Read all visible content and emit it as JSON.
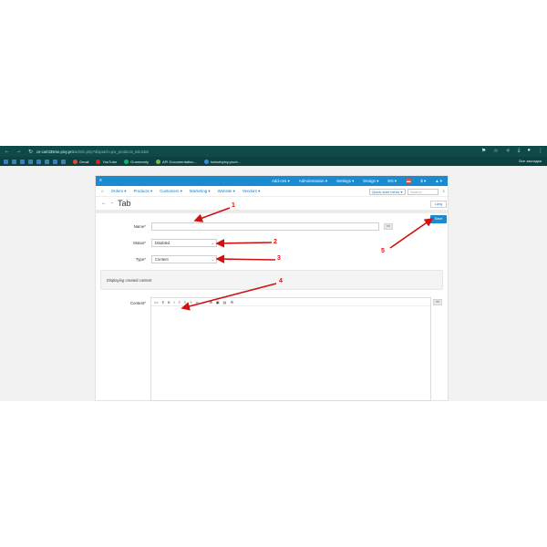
{
  "browser": {
    "url_host": "cs-cart435me.pixy.pro",
    "url_path": "/admin.php?dispatch=pw_products_tab.tabs",
    "bookmarks": [
      {
        "label": "Gmail",
        "color": "#e14a3a"
      },
      {
        "label": "YouTube",
        "color": "#e02020"
      },
      {
        "label": "Grammarly",
        "color": "#15b06b"
      },
      {
        "label": "API Documentation...",
        "color": "#7ab648"
      },
      {
        "label": "hotwebpixy.pro/e...",
        "color": "#3b8cd8"
      }
    ],
    "bookmarks_right": "Все закладки"
  },
  "topbar": {
    "items": [
      "Add-ons ▾",
      "Administration ▾",
      "Settings ▾",
      "Design ▾",
      "EN ▾",
      "$ ▾",
      "▲ ▾"
    ]
  },
  "menu": {
    "items": [
      "Orders ▾",
      "Products ▾",
      "Customers ▾",
      "Marketing ▾",
      "Website ▾",
      "Vendors ▾"
    ],
    "quick_start": "Quick start menu ▾",
    "search_placeholder": "Search"
  },
  "page": {
    "title": "Tab",
    "lang_button": "Lang",
    "save_button": "Save"
  },
  "form": {
    "name_label": "Name",
    "name_value": "",
    "status_label": "Status",
    "status_value": "Disabled",
    "type_label": "Type",
    "type_value": "Content",
    "lang_code": "en",
    "info_text": "Displaying created content",
    "content_label": "Content",
    "required_mark": "*"
  },
  "editor": {
    "toolbar": [
      "<>",
      "¶",
      "B",
      "I",
      "≡",
      "≡",
      "≡",
      "∞",
      "—",
      "⊞",
      "▣",
      "▤",
      "⚙"
    ]
  },
  "annotations": {
    "labels": [
      "1",
      "2",
      "3",
      "4",
      "5"
    ],
    "color": "#d11111"
  }
}
